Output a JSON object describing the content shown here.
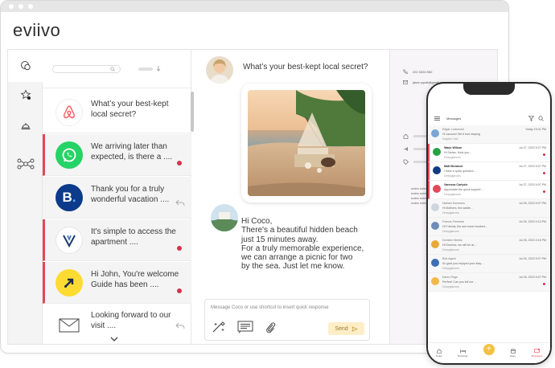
{
  "brand": "eviivo",
  "inbox": {
    "conversations": [
      {
        "text": "What’s your best-kept local secret?",
        "logo": "airbnb-icon",
        "unread": false,
        "dot": false,
        "reply": false
      },
      {
        "text": "We arriving later than expected, is there a ....",
        "logo": "whatsapp-icon",
        "unread": true,
        "dot": true,
        "reply": false
      },
      {
        "text": "Thank you for a truly wonderful vacation ....",
        "logo": "booking-icon",
        "unread": false,
        "dot": false,
        "reply": true
      },
      {
        "text": "It's simple to access the apartment ....",
        "logo": "vrbo-icon",
        "unread": true,
        "dot": true,
        "reply": false
      },
      {
        "text": "Hi John, You're welcome Guide has been ....",
        "logo": "expedia-icon",
        "unread": true,
        "dot": true,
        "reply": false
      },
      {
        "text": "Looking forward to our visit ....",
        "logo": "email-icon",
        "unread": false,
        "dot": false,
        "reply": true
      }
    ]
  },
  "chat": {
    "question": "What’s your best-kept local secret?",
    "answer_lines": [
      "Hi Coco,",
      "There's a beautiful hidden beach",
      "just 15 minutes away.",
      "For a truly memorable experience,",
      "we can arrange a picnic for two",
      "by the sea. Just let me know."
    ],
    "composer_placeholder": "Message Coco or use shortcut to insert quick response",
    "send_label": "Send"
  },
  "details": {
    "phone": "222 3333 952",
    "email": "jason.pyott@gmail.com",
    "notes": [
      "notes notes no",
      "notes notes no",
      "notes notes no",
      "notes notes no"
    ]
  },
  "phone": {
    "header_title": "Messages",
    "items": [
      {
        "name": "Edgar Lockwood",
        "msg": "I'll vacuum! We'd love staying",
        "prop": "Dolphin Hall",
        "time": "Today 15:01 PM",
        "unread": false,
        "dot": false,
        "color": "#7aa6d6"
      },
      {
        "name": "Wade Wilson",
        "msg": "Hi Stefan, think you...",
        "prop": "Deepglances",
        "time": "Jul 27, 2023 5:07 PM",
        "unread": true,
        "dot": true,
        "color": "#25a244"
      },
      {
        "name": "Matt Murdock",
        "msg": "I have a quick question ....",
        "prop": "Deepglances",
        "time": "Jul 27, 2023 5:07 PM",
        "unread": true,
        "dot": true,
        "color": "#0f3b82"
      },
      {
        "name": "Vanessa Carlysle",
        "msg": "Appreciate the quick support....",
        "prop": "Deepglances",
        "time": "Jul 27, 2023 5:07 PM",
        "unread": true,
        "dot": true,
        "color": "#e04a59"
      },
      {
        "name": "Nathan Summers",
        "msg": "Hi Mothers, the castle...",
        "prop": "Deepglances",
        "time": "Jul 26, 2023 5:07 PM",
        "unread": false,
        "dot": false,
        "color": "#d0d6df"
      },
      {
        "name": "Francis Freeman",
        "msg": "Hi Friends, the see tower booked...",
        "prop": "Deepglances",
        "time": "Jul 26, 2023 4:13 PM",
        "unread": false,
        "dot": false,
        "color": "#6f8db8"
      },
      {
        "name": "Dominic Meeks",
        "msg": "Hi Dominic, we will be at....",
        "prop": "Deepglances",
        "time": "Jul 26, 2023 4:16 PM",
        "unread": false,
        "dot": false,
        "color": "#e8a93a"
      },
      {
        "name": "Bob Agent",
        "msg": "So glad you enjoyed your stay....",
        "prop": "Deepglances",
        "time": "Jul 26, 2023 5:07 PM",
        "unread": false,
        "dot": false,
        "color": "#3d6fb5"
      },
      {
        "name": "Karen Page",
        "msg": "Perfect! Can you tell me ...",
        "prop": "Deepglances",
        "time": "Jul 26, 2023 5:07 PM",
        "unread": false,
        "dot": true,
        "color": "#f2b84b"
      }
    ],
    "nav": [
      "Today",
      "Bookings",
      "",
      "Diary",
      "Messages"
    ]
  },
  "colors": {
    "accent_red": "#e04a59",
    "send_bg": "#fdeec7",
    "details_bg": "#f7f5f7"
  }
}
